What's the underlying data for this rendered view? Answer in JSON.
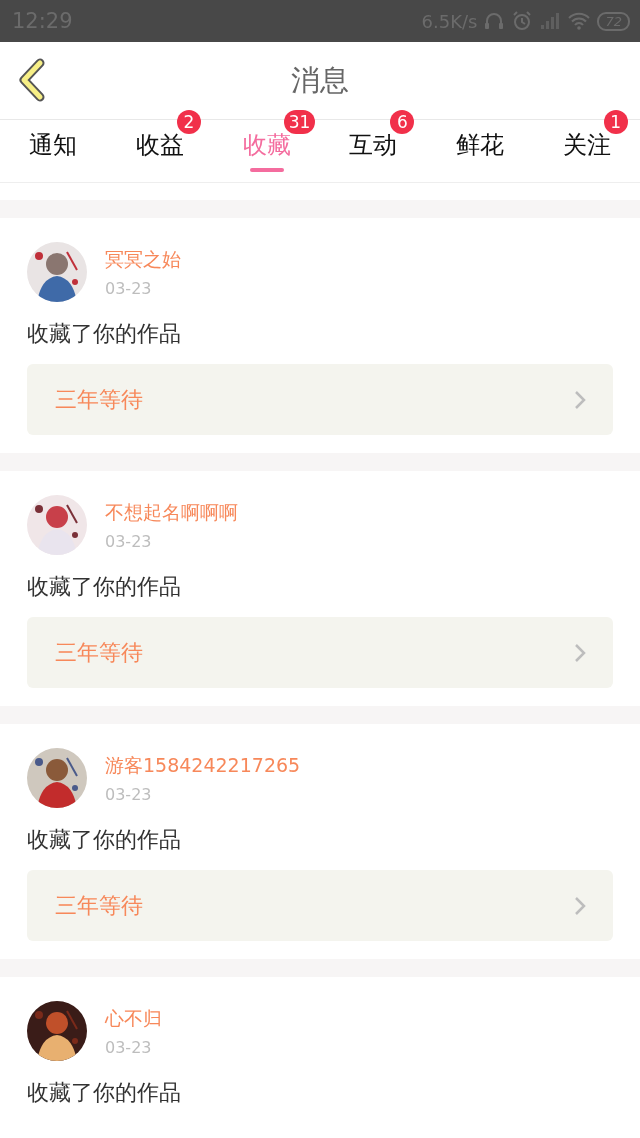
{
  "status_bar": {
    "time": "12:29",
    "net_speed": "6.5K/s",
    "battery": "72"
  },
  "header": {
    "title": "消息"
  },
  "tabs": [
    {
      "label": "通知",
      "selected": false
    },
    {
      "label": "收益",
      "badge": "2",
      "selected": false
    },
    {
      "label": "收藏",
      "badge": "31",
      "selected": true
    },
    {
      "label": "互动",
      "badge": "6",
      "selected": false
    },
    {
      "label": "鲜花",
      "selected": false
    },
    {
      "label": "关注",
      "badge": "1",
      "selected": false
    }
  ],
  "messages": [
    {
      "user": "冥冥之始",
      "date": "03-23",
      "text": "收藏了你的作品",
      "work": "三年等待"
    },
    {
      "user": "不想起名啊啊啊",
      "date": "03-23",
      "text": "收藏了你的作品",
      "work": "三年等待"
    },
    {
      "user": "游客1584242217265",
      "date": "03-23",
      "text": "收藏了你的作品",
      "work": "三年等待"
    },
    {
      "user": "心不归",
      "date": "03-23",
      "text": "收藏了你的作品"
    }
  ]
}
